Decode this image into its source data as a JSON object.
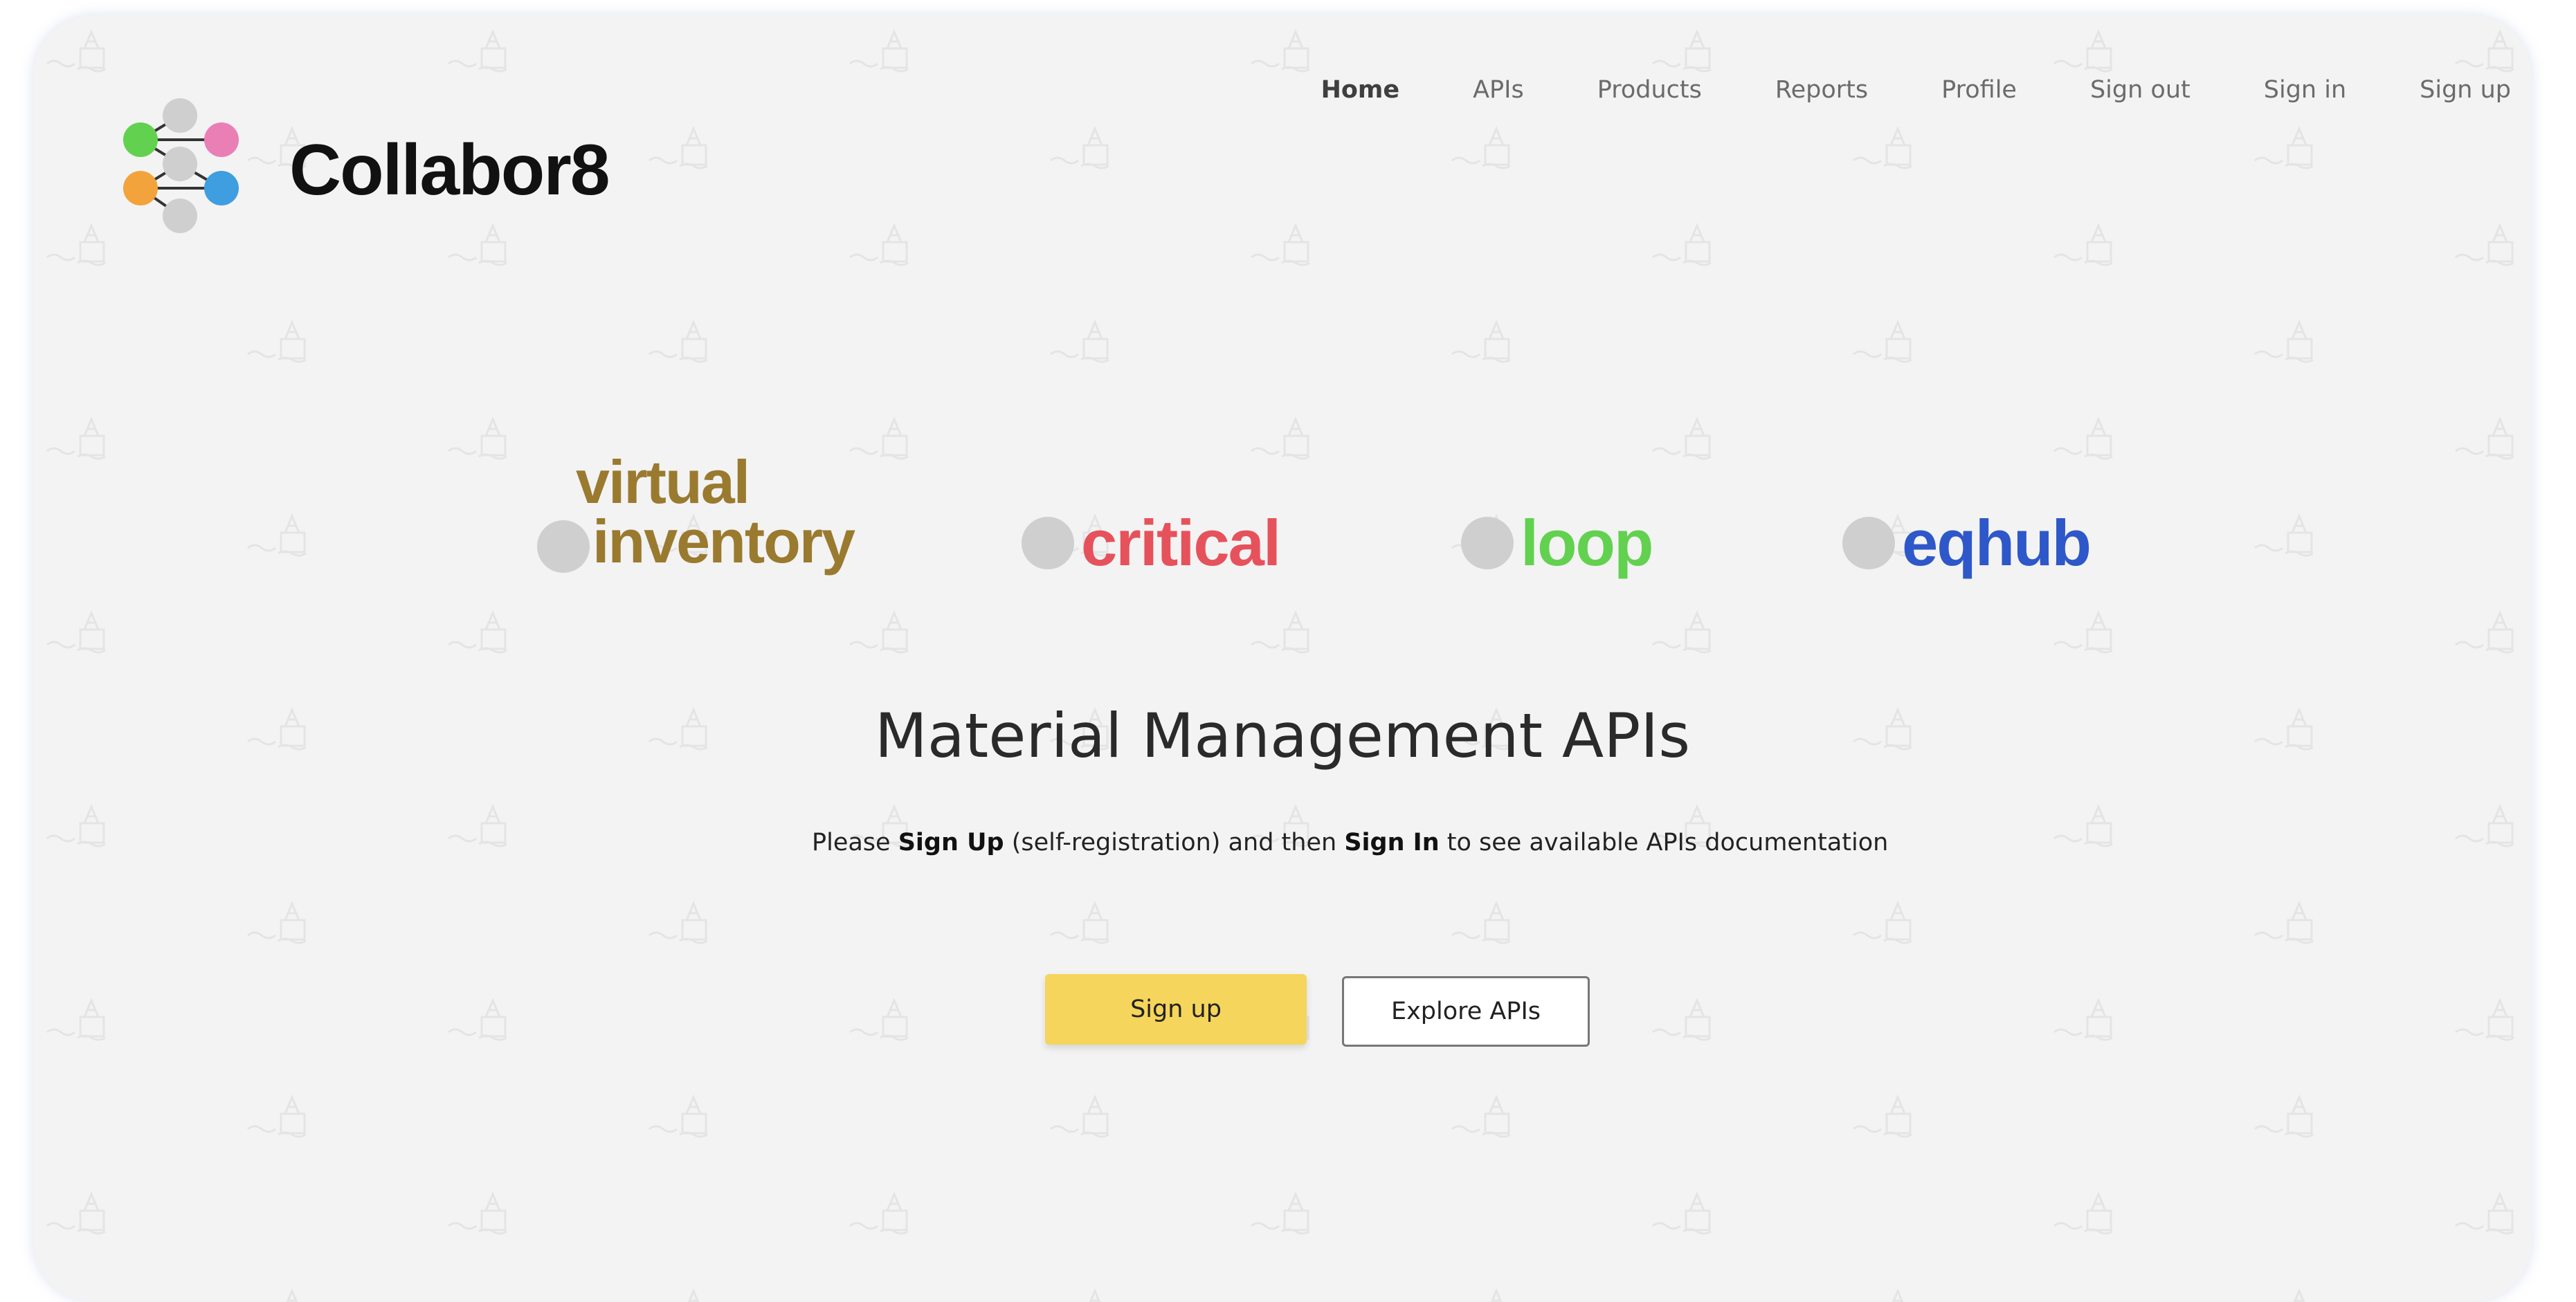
{
  "brand": {
    "name": "Collabor8"
  },
  "nav": {
    "items": [
      {
        "label": "Home"
      },
      {
        "label": "APIs"
      },
      {
        "label": "Products"
      },
      {
        "label": "Reports"
      },
      {
        "label": "Profile"
      },
      {
        "label": "Sign out"
      },
      {
        "label": "Sign in"
      },
      {
        "label": "Sign up"
      }
    ]
  },
  "products": {
    "virtual_inventory": {
      "line1": "virtual",
      "line2": "inventory",
      "color": "#9a7a2f"
    },
    "critical": {
      "label": "critical",
      "color": "#e6525c"
    },
    "loop": {
      "label": "loop",
      "color": "#62d150"
    },
    "eqhub": {
      "label": "eqhub",
      "color": "#2e58c9"
    }
  },
  "hero": {
    "title": "Material Management APIs",
    "sub_part1": "Please ",
    "sub_bold1": "Sign Up",
    "sub_part2": " (self-registration) and then ",
    "sub_bold2": "Sign In",
    "sub_part3": " to see available APIs documentation"
  },
  "actions": {
    "signup_label": "Sign up",
    "explore_label": "Explore APIs"
  },
  "colors": {
    "background": "#f3f3f3",
    "signup_button": "#f5d55b"
  }
}
